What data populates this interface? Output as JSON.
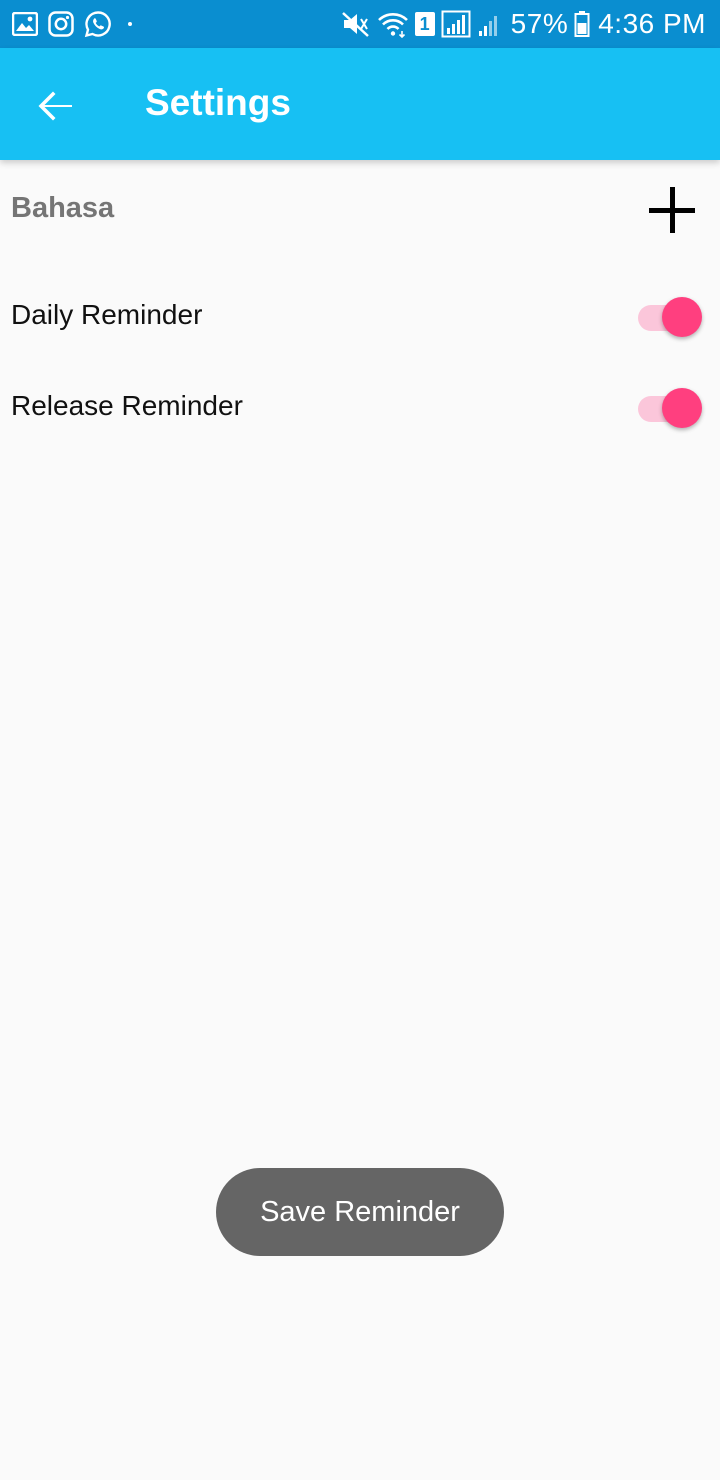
{
  "status_bar": {
    "notification_icons": [
      "gallery-icon",
      "instagram-icon",
      "whatsapp-icon",
      "more-dot-icon"
    ],
    "system_icons": [
      "mute-icon",
      "wifi-icon",
      "sim-badge",
      "signal-icon",
      "signal-icon-2",
      "battery-icon"
    ],
    "sim_number": "1",
    "battery": "57%",
    "time": "4:36 PM"
  },
  "app_bar": {
    "title": "Settings",
    "back_icon": "arrow-back-icon",
    "color": "#17c0f3"
  },
  "settings": {
    "language_label": "Bahasa",
    "add_icon": "plus-icon",
    "items": [
      {
        "label": "Daily Reminder",
        "enabled": true
      },
      {
        "label": "Release Reminder",
        "enabled": true
      }
    ],
    "switch_on_color": "#ff3f7f"
  },
  "toast": {
    "text": "Save Reminder"
  }
}
